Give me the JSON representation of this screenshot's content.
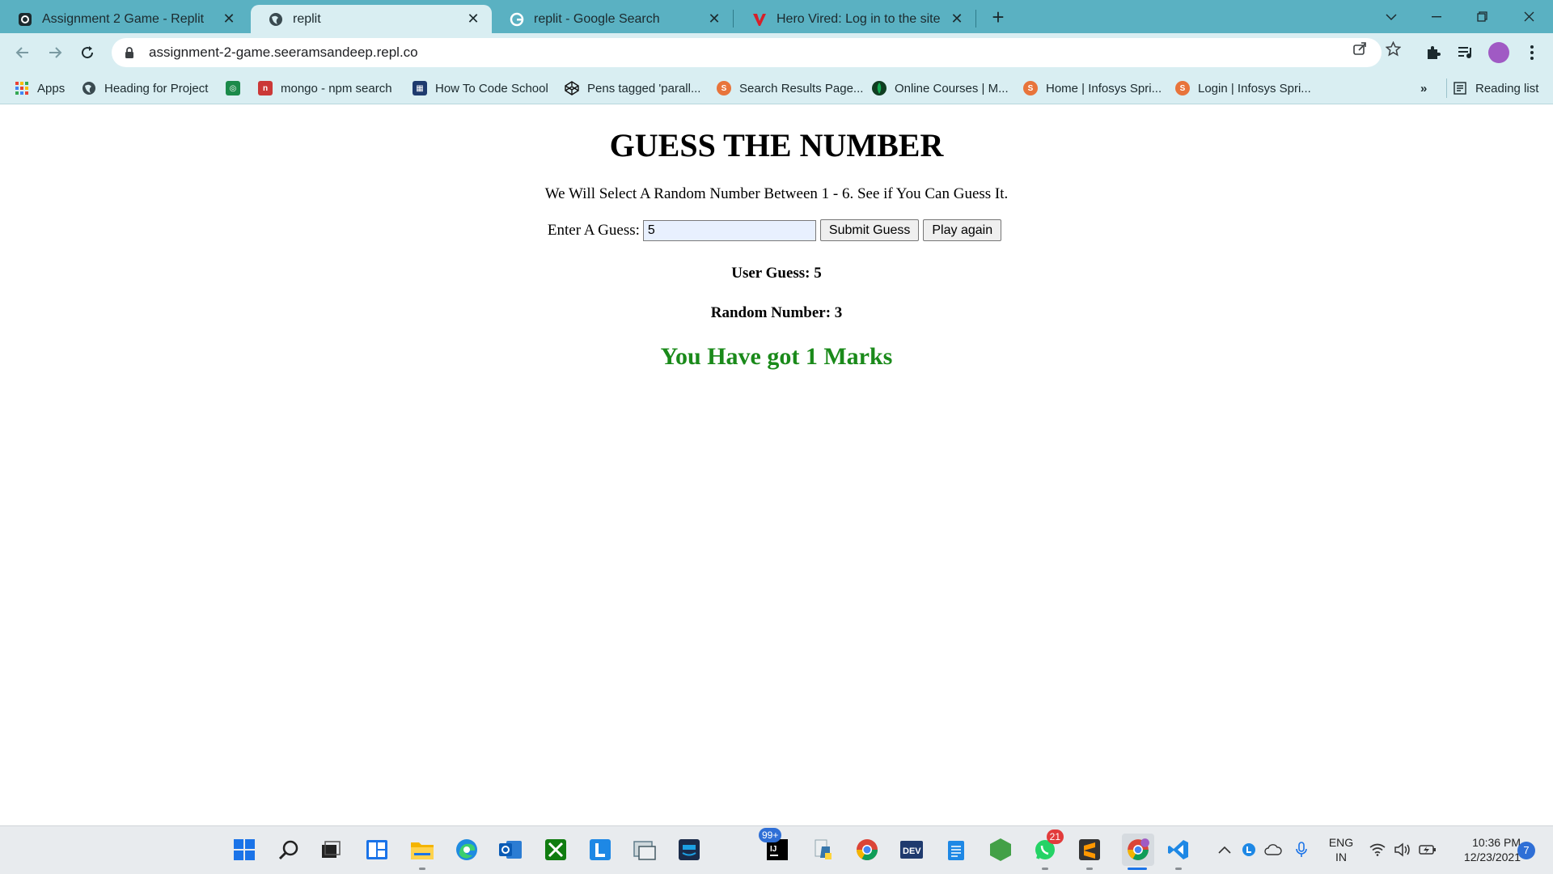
{
  "browser": {
    "tabs": [
      {
        "title": "Assignment 2 Game - Replit",
        "favicon": "replit-icon"
      },
      {
        "title": "replit",
        "favicon": "globe-icon"
      },
      {
        "title": "replit - Google Search",
        "favicon": "google-icon"
      },
      {
        "title": "Hero Vired: Log in to the site",
        "favicon": "herovired-icon"
      }
    ],
    "active_tab": 1,
    "url": "assignment-2-game.seeramsandeep.repl.co",
    "bookmarks": [
      {
        "label": "Apps",
        "icon": "apps-grid-icon"
      },
      {
        "label": "Heading for Project",
        "icon": "globe-icon"
      },
      {
        "label": "",
        "icon": "green-app-icon"
      },
      {
        "label": "mongo - npm search",
        "icon": "npm-icon"
      },
      {
        "label": "How To Code School",
        "icon": "school-icon"
      },
      {
        "label": "Pens tagged 'parall...",
        "icon": "codepen-icon"
      },
      {
        "label": "Search Results Page...",
        "icon": "infosys-icon"
      },
      {
        "label": "Online Courses | M...",
        "icon": "mongodb-icon"
      },
      {
        "label": "Home | Infosys Spri...",
        "icon": "infosys-icon"
      },
      {
        "label": "Login | Infosys Spri...",
        "icon": "infosys-icon"
      }
    ],
    "reading_list": "Reading list",
    "overflow": "»"
  },
  "page": {
    "heading": "GUESS THE NUMBER",
    "description": "We Will Select A Random Number Between 1 - 6. See if You Can Guess It.",
    "guess_label": "Enter A Guess:",
    "guess_value": "5",
    "submit_label": "Submit Guess",
    "play_again_label": "Play again",
    "user_guess": "User Guess: 5",
    "random_number": "Random Number: 3",
    "result": "You Have got 1 Marks",
    "result_color": "#1a8a1a"
  },
  "taskbar": {
    "apps": [
      "windows-start-icon",
      "search-icon",
      "task-view-icon",
      "widgets-icon",
      "file-explorer-icon",
      "edge-icon",
      "outlook-icon",
      "xbox-icon",
      "l-app-icon",
      "snipping-icon",
      "prime-video-icon",
      "intellij-icon",
      "python-icon",
      "chrome-icon",
      "dev-icon",
      "notepad-icon",
      "node-icon",
      "whatsapp-icon",
      "sublime-icon",
      "chrome-profile-icon",
      "vscode-icon"
    ],
    "mail_badge": "99+",
    "whatsapp_badge": "21",
    "language_line1": "ENG",
    "language_line2": "IN",
    "time": "10:36 PM",
    "date": "12/23/2021",
    "notifications": "7"
  }
}
